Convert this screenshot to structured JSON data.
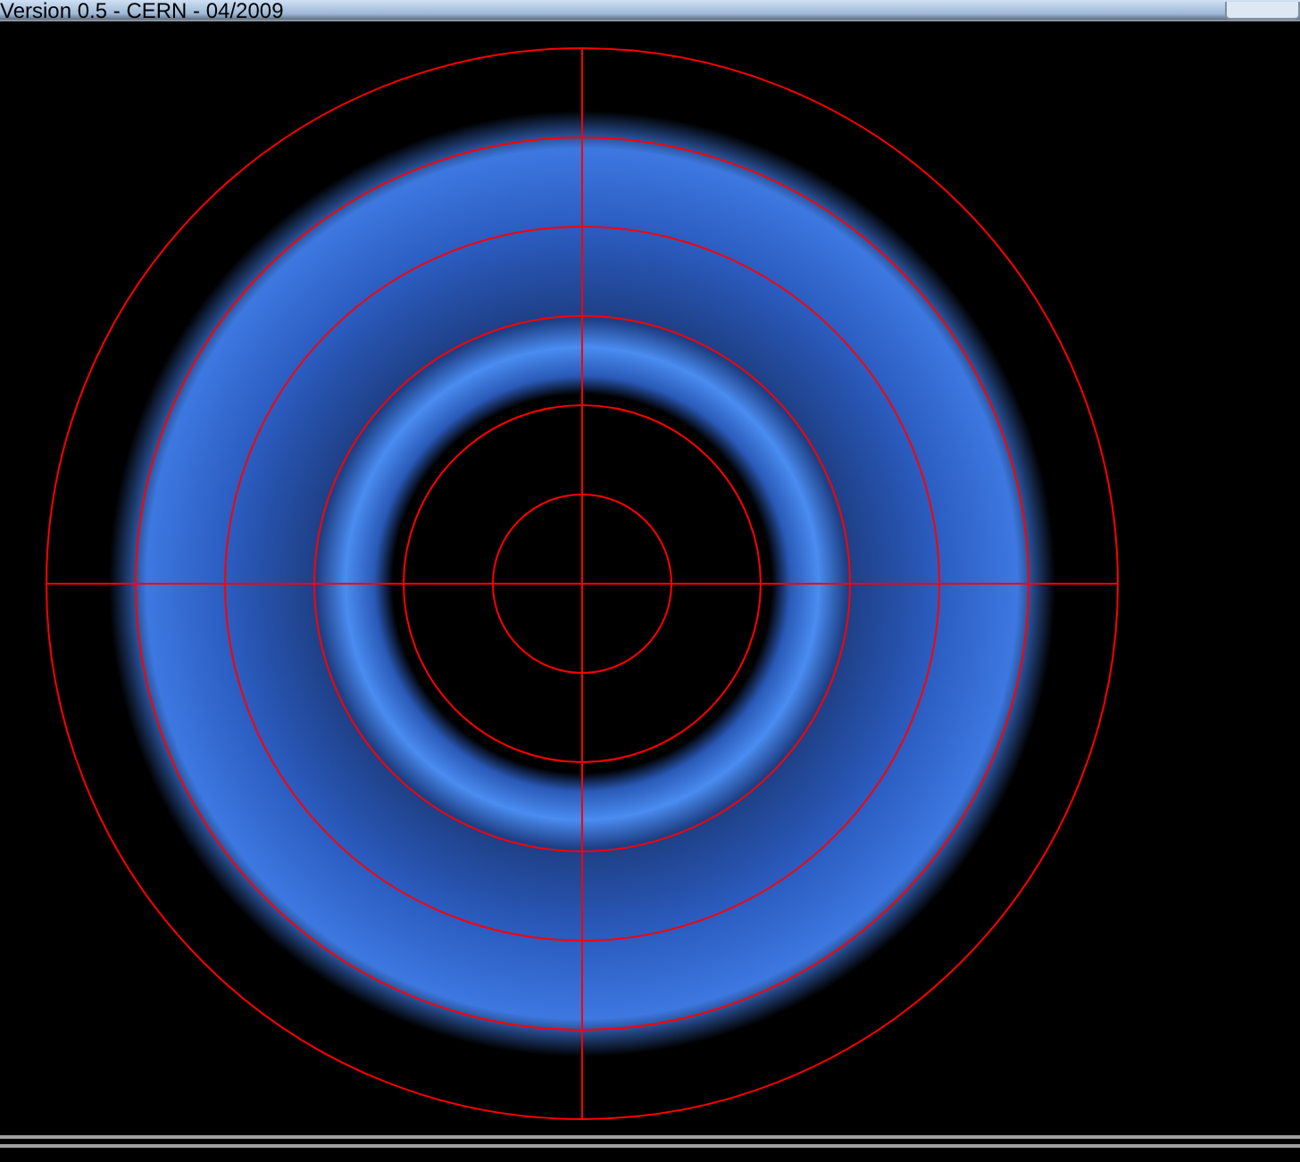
{
  "window": {
    "title": "Version 0.5 - CERN - 04/2009"
  }
}
